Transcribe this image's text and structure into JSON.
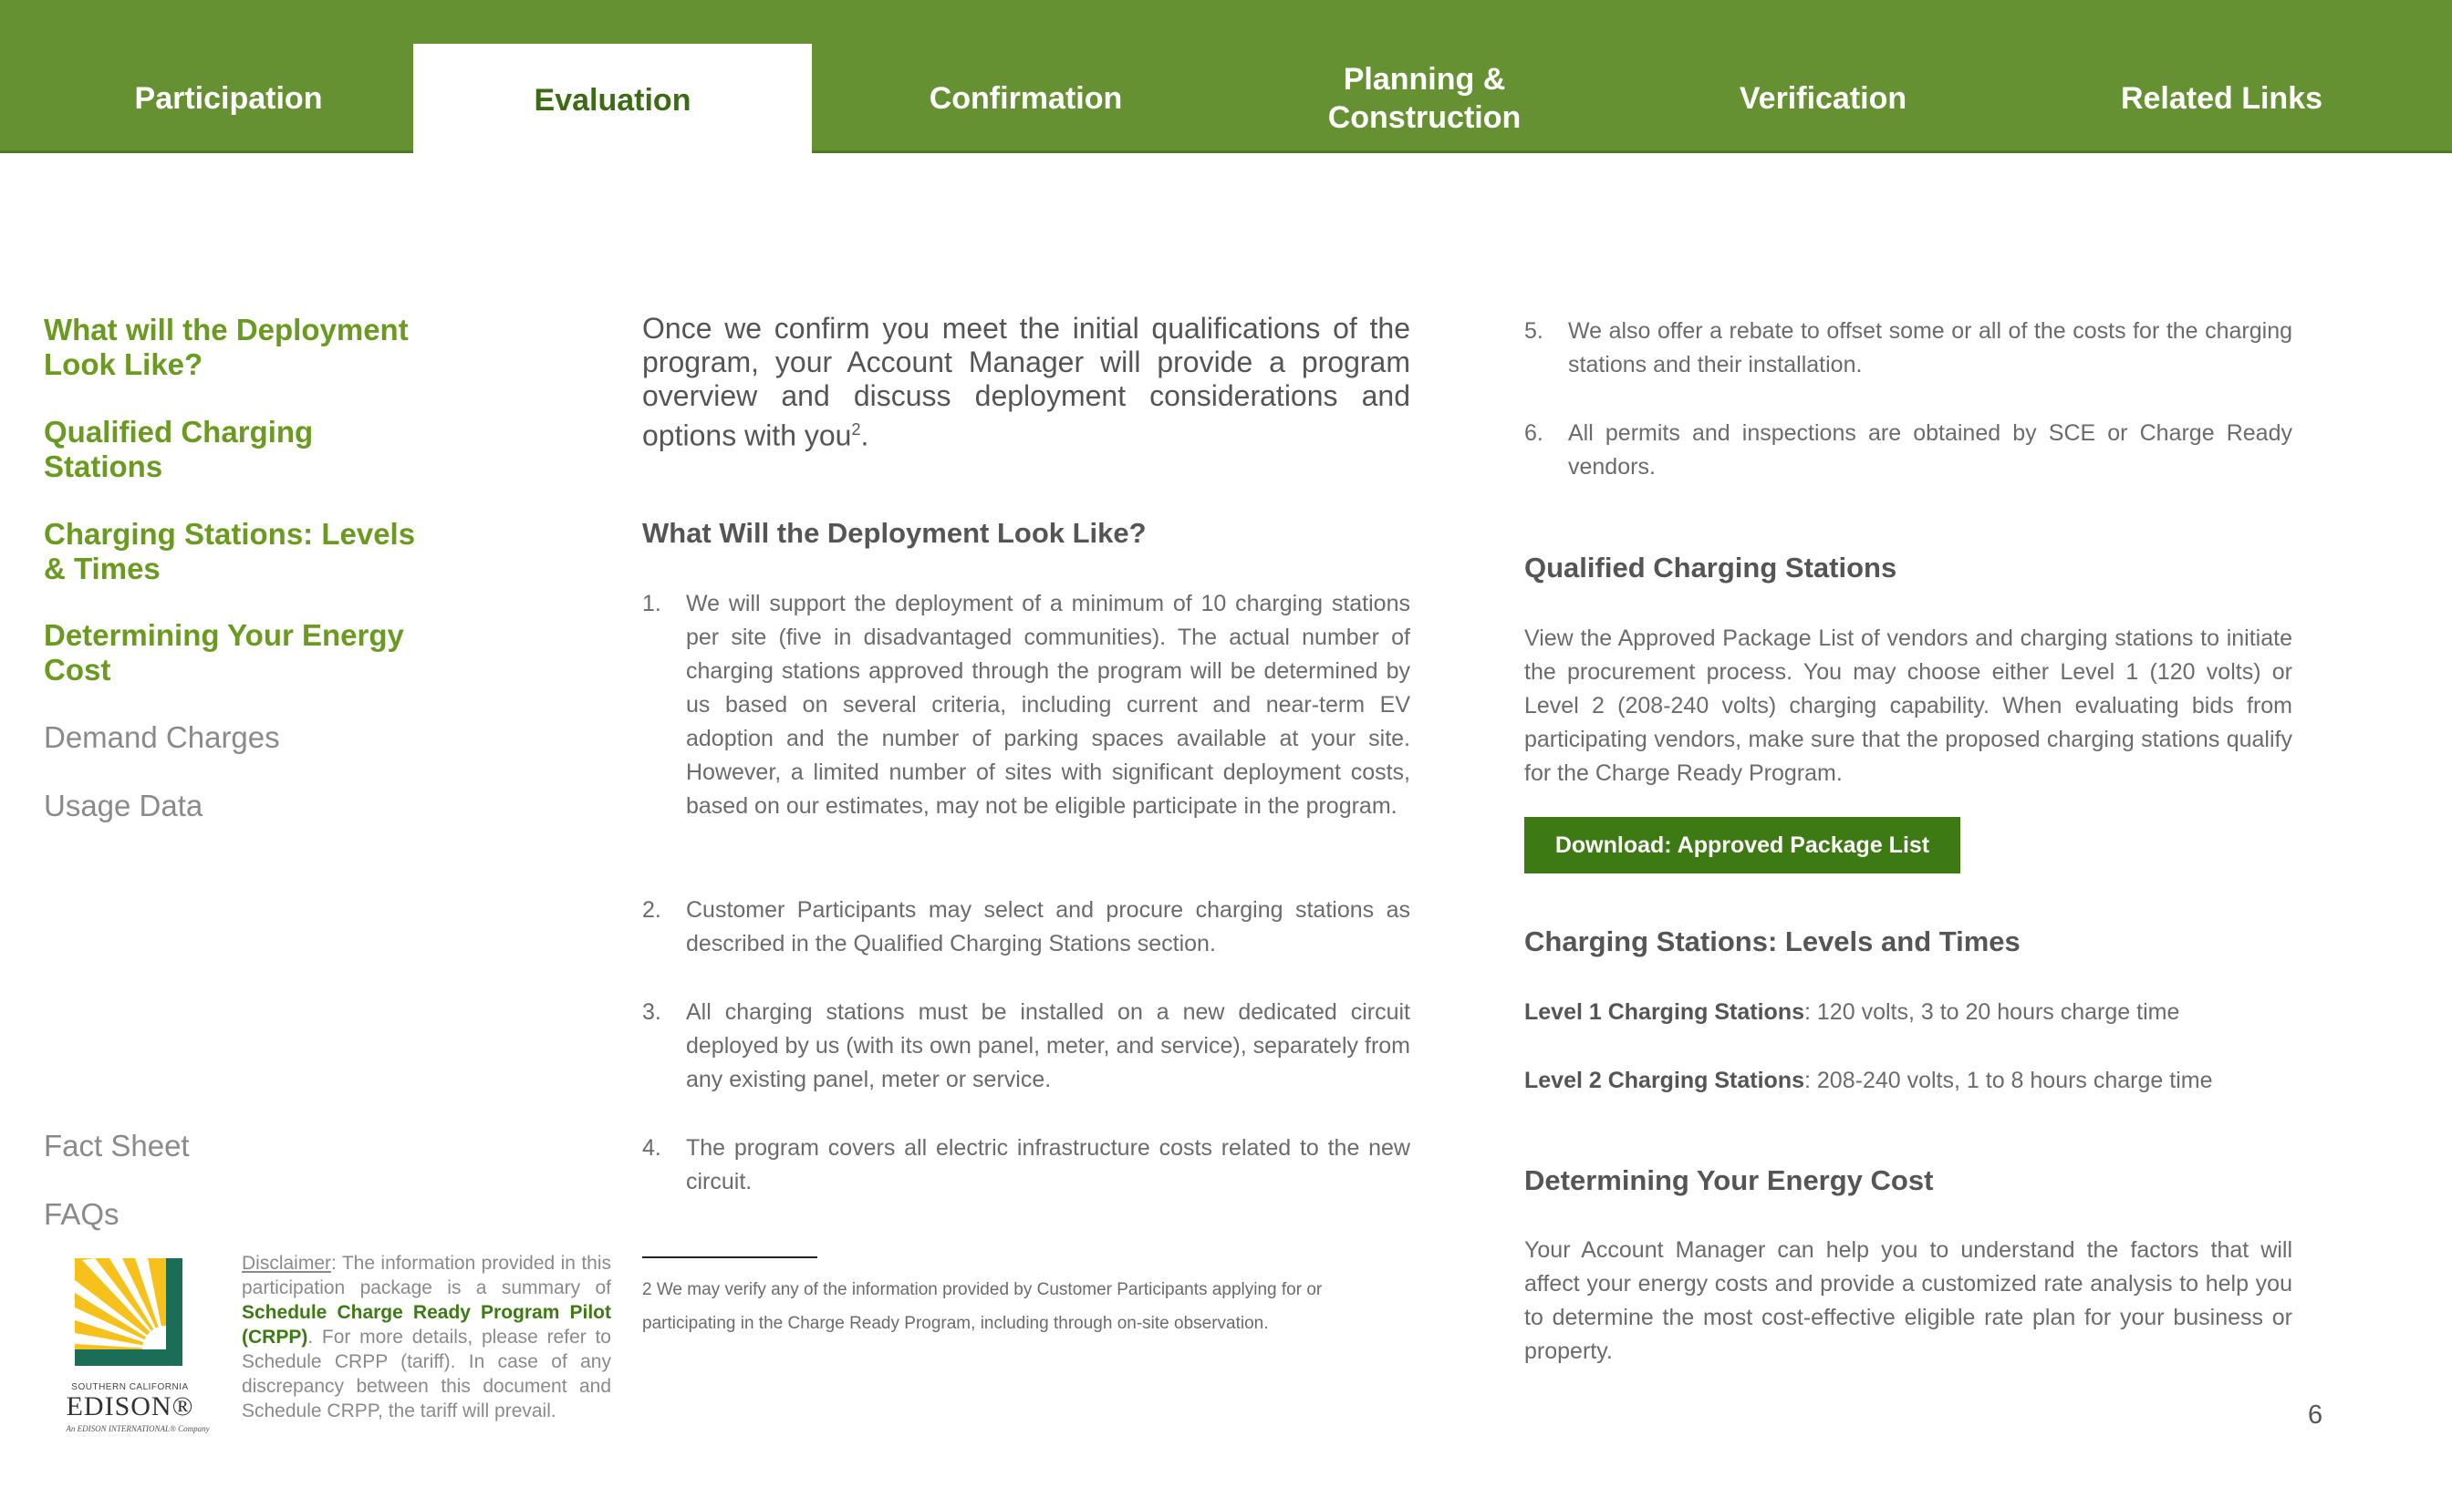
{
  "nav": {
    "tabs": [
      {
        "label": "Participation"
      },
      {
        "label": "Evaluation"
      },
      {
        "label": "Confirmation"
      },
      {
        "line1": "Planning &",
        "line2": "Construction"
      },
      {
        "label": "Verification"
      },
      {
        "label": "Related Links"
      }
    ]
  },
  "sidebar": {
    "links": [
      {
        "line1": "What will the Deployment",
        "line2": "Look Like?"
      },
      {
        "line1": "Qualified Charging",
        "line2": "Stations"
      },
      {
        "line1": "Charging Stations: Levels",
        "line2": "& Times"
      },
      {
        "line1": "Determining Your Energy",
        "line2": "Cost"
      },
      {
        "label": "Demand Charges"
      },
      {
        "label": "Usage Data"
      },
      {
        "label": "Fact Sheet"
      },
      {
        "label": "FAQs"
      }
    ]
  },
  "logo": {
    "small": "SOUTHERN CALIFORNIA",
    "name": "EDISON®",
    "tagline": "An EDISON INTERNATIONAL® Company"
  },
  "disclaimer": {
    "label": "Disclaimer",
    "text1": ": The information provided in this participation package is a summary of ",
    "link": "Schedule Charge Ready Program Pilot (CRPP)",
    "text2": ". For more details, please refer to Schedule CRPP (tariff). In case of any discrepancy between this document and Schedule CRPP, the tariff will prevail."
  },
  "main": {
    "intro": "Once we confirm you meet the initial qualifications of the program, your Account Manager will provide a program overview and discuss deployment considerations and options with you",
    "intro_sup": "2",
    "intro_end": ".",
    "deployment_heading": "What Will the Deployment Look Like?",
    "items": [
      {
        "num": "1.",
        "text": "We will support the deployment of a minimum of 10 charging stations per site (five in disadvantaged communities). The actual number of charging stations approved through the program will be determined by us based on several criteria, including current and near-term EV adoption and the number of parking spaces available at your site. However, a limited number of sites with significant deployment costs, based on our estimates, may not be eligible participate in the program."
      },
      {
        "num": "2.",
        "text": "Customer Participants may select and procure charging stations as described in the Qualified Charging Stations section."
      },
      {
        "num": "3.",
        "text": "All charging stations must be installed on a new dedicated circuit deployed by us (with its own panel, meter, and service), separately from any existing panel, meter or service."
      },
      {
        "num": "4.",
        "text": "The program covers all electric infrastructure costs related to the new circuit."
      },
      {
        "num": "5.",
        "text": "We also offer a rebate to offset some or all of the costs for the charging stations and their installation."
      },
      {
        "num": "6.",
        "text": "All permits and inspections are obtained by SCE or Charge Ready vendors."
      }
    ],
    "footnote": "2   We may verify any of the information provided by Customer Participants applying for or participating in the Charge Ready Program, including through on-site observation."
  },
  "right": {
    "qualified_heading": "Qualified Charging Stations",
    "qualified_text": "View the Approved Package List of vendors and charging stations to initiate the procurement process. You may choose either Level 1 (120 volts) or Level 2 (208-240 volts) charging capability. When evaluating bids from participating vendors, make sure that the proposed charging stations qualify for the Charge Ready Program.",
    "download_label": "Download: Approved Package List",
    "levels_heading": "Charging Stations: Levels and Times",
    "level1_label": "Level 1 Charging Stations",
    "level1_text": ": 120 volts, 3 to 20 hours charge time",
    "level2_label": "Level 2 Charging Stations",
    "level2_text": ": 208-240 volts, 1 to 8 hours charge time",
    "energy_heading": "Determining Your Energy Cost",
    "energy_text": "Your Account Manager can help you to understand the factors that will affect your energy costs and provide a customized rate analysis to help you to determine the most cost-effective eligible rate plan for your business or property."
  },
  "page_number": "6",
  "colors": {
    "nav_green": "#669132",
    "link_green": "#6a9b20",
    "button_green": "#3d7a14",
    "logo_yellow": "#f6c11a",
    "logo_teal": "#1a6e57"
  }
}
